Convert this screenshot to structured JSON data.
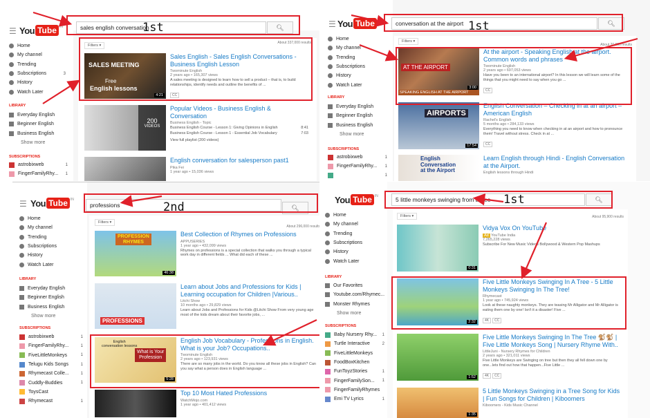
{
  "panels": [
    {
      "search_query": "sales english conversation",
      "annotation": "1st",
      "filters_label": "Filters ▾",
      "about": "About 337,000 results",
      "nav": [
        "Home",
        "My channel",
        "Trending",
        "Subscriptions",
        "History",
        "Watch Later"
      ],
      "subscriptions_count": "3",
      "library_label": "LIBRARY",
      "library": [
        "Everyday English",
        "Beginner English",
        "Business English"
      ],
      "show_more": "Show more",
      "subs_label": "SUBSCRIPTIONS",
      "subs": [
        {
          "name": "astrobixweb",
          "count": "1"
        },
        {
          "name": "FingerFamilyRhy...",
          "count": "1"
        }
      ],
      "results": [
        {
          "title": "Sales English - Sales English Conversations - Business English Lesson",
          "channel": "Twominute English",
          "meta": "2 years ago • 165,307 views",
          "desc": "A sales meeting is designed to learn how to sell a product – that is, to build relationships, identify needs and outline the benefits of ...",
          "badge": "CC",
          "duration": "4:21",
          "thumb_lines": [
            "SALES MEETING",
            "Free",
            "English lessons"
          ]
        },
        {
          "title": "Popular Videos - Business English & Conversation",
          "channel": "Business English - Topic",
          "lines": [
            "Business English Course - Lesson 1: Giving Opinions in English",
            "Business English Course - Lesson 1 - Essential Job Vocabulary"
          ],
          "line_times": [
            "8:41",
            "7:03"
          ],
          "playlist": "View full playlist (200 videos)",
          "thumb_count": "200",
          "thumb_label": "VIDEOS"
        },
        {
          "title": "English conversation for salesperson past1",
          "channel": "Pika Fei",
          "meta": "1 year ago • 15,036 views"
        }
      ]
    },
    {
      "search_query": "conversation at the airport",
      "annotation": "1st",
      "filters_label": "Filters ▾",
      "about": "About 20,000 results",
      "nav": [
        "Home",
        "My channel",
        "Trending",
        "Subscriptions",
        "History",
        "Watch Later"
      ],
      "library_label": "LIBRARY",
      "library": [
        "Everyday English",
        "Beginner English",
        "Business English"
      ],
      "show_more": "Show more",
      "subs_label": "SUBSCRIPTIONS",
      "subs": [
        {
          "name": "astrobixweb",
          "count": "1"
        },
        {
          "name": "FingerFamilyRhy...",
          "count": "1"
        },
        {
          "name": "",
          "count": "1"
        }
      ],
      "results": [
        {
          "title": "At the airport - Speaking English at the airport. Common words and phrases",
          "channel": "Twominute English",
          "meta": "2 years ago • 697,053 views",
          "desc": "Have you been to an international airport? In this lesson we will learn some of the things that you might need to say when you go ...",
          "badge": "CC",
          "duration": "3:00",
          "thumb_lines": [
            "AT THE AIRPORT",
            "SPEAKING ENGLISH AT THE AIRPORT"
          ]
        },
        {
          "title": "English Conversation – Checking in at an airport – American English",
          "channel": "Rachel's English",
          "meta": "5 months ago • 284,133 views",
          "desc": "Everything you need to know when checking in at an airport and how to pronounce them! Travel without stress. Check in at ...",
          "badge": "CC",
          "duration": "17:54",
          "thumb_lines": [
            "AIRPORTS"
          ]
        },
        {
          "title": "Learn English through Hindi - English Conversation at the Airport.",
          "channel": "English lessons through Hindi",
          "thumb_lines": [
            "English",
            "Conversation",
            "at the Airport"
          ]
        }
      ]
    },
    {
      "search_query": "professions",
      "annotation": "2nd",
      "filters_label": "Filters ▾",
      "about": "About 296,000 results",
      "nav": [
        "Home",
        "My channel",
        "Trending",
        "Subscriptions",
        "History",
        "Watch Later"
      ],
      "library_label": "LIBRARY",
      "library": [
        "Everyday English",
        "Beginner English",
        "Business English"
      ],
      "show_more": "Show more",
      "subs_label": "SUBSCRIPTIONS",
      "subs": [
        {
          "name": "astrobixweb",
          "count": "1"
        },
        {
          "name": "FingerFamilyRhy...",
          "count": "1"
        },
        {
          "name": "FiveLittleMonkeys",
          "count": "1"
        },
        {
          "name": "Telugu Kids Songs",
          "count": "1"
        },
        {
          "name": "Rhymecast Colle...",
          "count": "1"
        },
        {
          "name": "Cuddly-Buddies",
          "count": "1"
        },
        {
          "name": "ToysCast",
          "count": ""
        },
        {
          "name": "Rhymecast",
          "count": "1"
        }
      ],
      "results": [
        {
          "title": "Best Collection of Rhymes on Professions",
          "channel": "APPUSERIES",
          "meta": "1 year ago • 432,099 views",
          "desc": "Rhymes on professions is a special collection that walks you through a typical work day in different fields ... What did each of these ...",
          "duration": "46:38",
          "thumb_lines": [
            "PROFESSION",
            "RHYMES"
          ]
        },
        {
          "title": "Learn about Jobs and Professions for Kids | Learning occupation for Children |Various..",
          "channel": "Litchi Show",
          "meta": "10 months ago • 29,829 views",
          "desc": "Learn about Jobs and Professions for Kids @Litchi Show From very young age most of the kids dream about their favorite jobs, ...",
          "thumb_lines": [
            "PROFESSIONS"
          ]
        },
        {
          "title": "English Job Vocabulary - Professions in English. What is your Job? Occupations..",
          "channel": "Twominute English",
          "meta": "2 years ago • 123,931 views",
          "desc": "There are so many jobs in the world. Do you know all these jobs in English? Can you say what a person does in English language ...",
          "duration": "5:28",
          "thumb_lines": [
            "English",
            "conversation lessons",
            "What is Your",
            "Profession"
          ]
        },
        {
          "title": "Top 10 Most Hated Professions",
          "channel": "WatchMojo.com",
          "meta": "1 year ago • 401,412 views"
        }
      ]
    },
    {
      "search_query": "5 little monkeys swinging from a tree",
      "annotation": "1st",
      "filters_label": "Filters ▾",
      "about": "About 95,900 results",
      "nav": [
        "Home",
        "My channel",
        "Trending",
        "Subscriptions",
        "History",
        "Watch Later"
      ],
      "library_label": "LIBRARY",
      "library": [
        "Our Favorites",
        "Youtube.com/Rhymec...",
        "Monster Rhymes"
      ],
      "show_more": "Show more",
      "subs_label": "SUBSCRIPTIONS",
      "subs": [
        {
          "name": "Baby Nursery Rhy...",
          "count": "1"
        },
        {
          "name": "Turtle Interactive",
          "count": "2"
        },
        {
          "name": "FiveLittleMonkeys",
          "count": ""
        },
        {
          "name": "FoodBoxKitchen",
          "count": ""
        },
        {
          "name": "FunToyzStories",
          "count": "1"
        },
        {
          "name": "FingerFamilySon...",
          "count": "1"
        },
        {
          "name": "FingerFamilyRhymes",
          "count": ""
        },
        {
          "name": "Emi TV Lyrics",
          "count": "1"
        }
      ],
      "results": [
        {
          "title": "Vidya Vox On YouTube",
          "ad": "Ad",
          "channel": "YouTube India",
          "meta": "7,265,228 views",
          "desc": "Subscribe For New Music Videos Bollywood & Western Pop Mashups",
          "duration": "0:31"
        },
        {
          "title": "Five Little Monkeys Swinging In A Tree - 5 Little Monkeys Swinging In The Tree!",
          "channel": "Rhymecast",
          "meta": "1 year ago • 745,924 views",
          "desc": "Look at these naughty monkeys. They are teasing Mr Alligator and Mr Alligator is eating them one by one! Isn't it a disaster! Five ...",
          "badges": [
            "4K",
            "CC"
          ],
          "duration": "2:32"
        },
        {
          "title": "Five Little Monkeys Swinging In The Tree 🐒🐒 | Five Little Monkeys Song | Nursery Rhyme With..",
          "channel": "LittleJuni - Nursery Rhymes for Children",
          "meta": "2 years ago • 321,011 views",
          "desc": "Five Little Monkeys are Swinging on tree but then they all fell down one by one...lets find out how that happen...Five Little ...",
          "badges": [
            "4K",
            "CC"
          ],
          "duration": "1:52"
        },
        {
          "title": "5 Little Monkeys Swinging in a Tree Song for Kids | Fun Songs for Children | Kiboomers",
          "channel": "Kiboomers - Kids Music Channel",
          "meta": "",
          "duration": "1:35"
        }
      ]
    }
  ],
  "colors": {
    "accent_red": "#e0202a",
    "link_blue": "#167ac6",
    "youtube_red": "#e62117"
  }
}
